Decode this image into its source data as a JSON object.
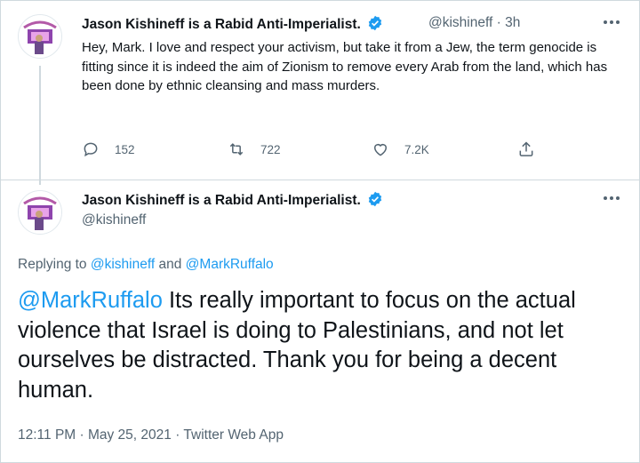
{
  "tweet1": {
    "display_name": "Jason Kishineff is a Rabid Anti-Imperialist.",
    "handle": "@kishineff",
    "separator": " · ",
    "time": "3h",
    "body": "Hey, Mark. I love and respect your activism, but take it from a Jew, the term genocide is fitting since it is indeed the aim of Zionism to remove every Arab from the land, which has been done by ethnic cleansing and mass murders.",
    "replies": "152",
    "retweets": "722",
    "likes": "7.2K"
  },
  "tweet2": {
    "display_name": "Jason Kishineff is a Rabid Anti-Imperialist.",
    "handle": "@kishineff",
    "replying_prefix": "Replying to ",
    "replying_to_1": "@kishineff",
    "replying_and": " and ",
    "replying_to_2": "@MarkRuffalo",
    "mention": "@MarkRuffalo",
    "text": " Its really important to focus on the actual violence that Israel is doing to Palestinians, and not let ourselves be distracted. Thank you for being a decent human.",
    "timestamp": "12:11 PM · May 25, 2021 · Twitter Web App"
  },
  "colors": {
    "accent": "#1d9bf0",
    "muted": "#536471",
    "text": "#0f1419",
    "border": "#cfd9de"
  },
  "icons": [
    "reply-icon",
    "retweet-icon",
    "like-icon",
    "share-icon",
    "verified-badge-icon",
    "more-options-icon"
  ]
}
